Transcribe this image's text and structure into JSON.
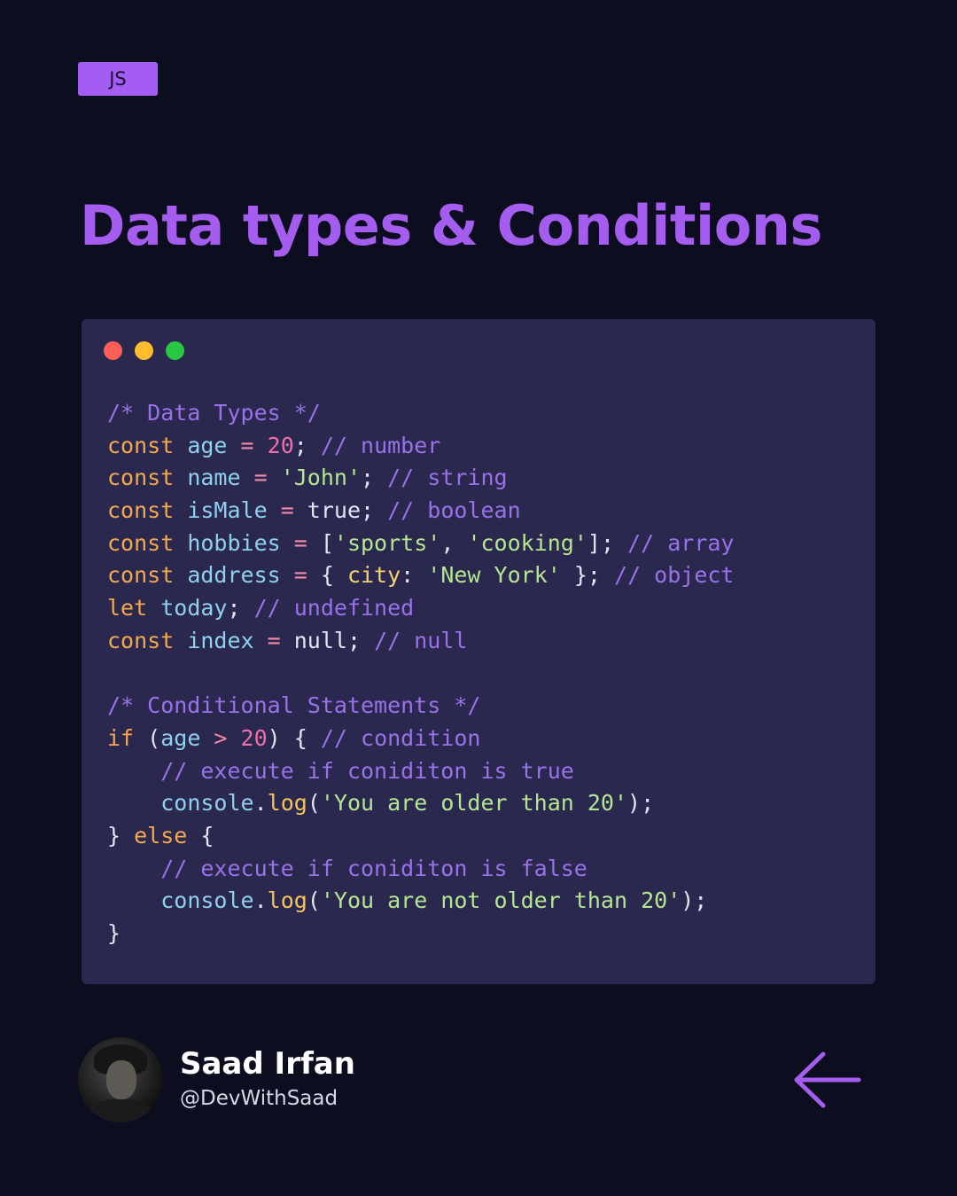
{
  "badge": {
    "label": "JS"
  },
  "title": "Data types & Conditions",
  "window_dots": {
    "colors": [
      "#ff5f57",
      "#febc2e",
      "#28c840"
    ]
  },
  "code": {
    "lines": [
      [
        {
          "t": "/* Data Types */",
          "c": "cm"
        }
      ],
      [
        {
          "t": "const",
          "c": "kw"
        },
        {
          "t": " ",
          "c": "pl"
        },
        {
          "t": "age",
          "c": "id"
        },
        {
          "t": " = ",
          "c": "op"
        },
        {
          "t": "20",
          "c": "num"
        },
        {
          "t": "; ",
          "c": "pl"
        },
        {
          "t": "// number",
          "c": "cm"
        }
      ],
      [
        {
          "t": "const",
          "c": "kw"
        },
        {
          "t": " ",
          "c": "pl"
        },
        {
          "t": "name",
          "c": "id"
        },
        {
          "t": " = ",
          "c": "op"
        },
        {
          "t": "'John'",
          "c": "str"
        },
        {
          "t": "; ",
          "c": "pl"
        },
        {
          "t": "// string",
          "c": "cm"
        }
      ],
      [
        {
          "t": "const",
          "c": "kw"
        },
        {
          "t": " ",
          "c": "pl"
        },
        {
          "t": "isMale",
          "c": "id"
        },
        {
          "t": " = ",
          "c": "op"
        },
        {
          "t": "true",
          "c": "pl"
        },
        {
          "t": "; ",
          "c": "pl"
        },
        {
          "t": "// boolean",
          "c": "cm"
        }
      ],
      [
        {
          "t": "const",
          "c": "kw"
        },
        {
          "t": " ",
          "c": "pl"
        },
        {
          "t": "hobbies",
          "c": "id"
        },
        {
          "t": " = ",
          "c": "op"
        },
        {
          "t": "[",
          "c": "pl"
        },
        {
          "t": "'sports'",
          "c": "str"
        },
        {
          "t": ", ",
          "c": "pl"
        },
        {
          "t": "'cooking'",
          "c": "str"
        },
        {
          "t": "]; ",
          "c": "pl"
        },
        {
          "t": "// array",
          "c": "cm"
        }
      ],
      [
        {
          "t": "const",
          "c": "kw"
        },
        {
          "t": " ",
          "c": "pl"
        },
        {
          "t": "address",
          "c": "id"
        },
        {
          "t": " = ",
          "c": "op"
        },
        {
          "t": "{ ",
          "c": "pl"
        },
        {
          "t": "city",
          "c": "prop"
        },
        {
          "t": ": ",
          "c": "pl"
        },
        {
          "t": "'New York'",
          "c": "str"
        },
        {
          "t": " }; ",
          "c": "pl"
        },
        {
          "t": "// object",
          "c": "cm"
        }
      ],
      [
        {
          "t": "let",
          "c": "kw"
        },
        {
          "t": " ",
          "c": "pl"
        },
        {
          "t": "today",
          "c": "id"
        },
        {
          "t": "; ",
          "c": "pl"
        },
        {
          "t": "// undefined",
          "c": "cm"
        }
      ],
      [
        {
          "t": "const",
          "c": "kw"
        },
        {
          "t": " ",
          "c": "pl"
        },
        {
          "t": "index",
          "c": "id"
        },
        {
          "t": " = ",
          "c": "op"
        },
        {
          "t": "null",
          "c": "pl"
        },
        {
          "t": "; ",
          "c": "pl"
        },
        {
          "t": "// null",
          "c": "cm"
        }
      ],
      [],
      [
        {
          "t": "/* Conditional Statements */",
          "c": "cm"
        }
      ],
      [
        {
          "t": "if",
          "c": "kw"
        },
        {
          "t": " (",
          "c": "pl"
        },
        {
          "t": "age",
          "c": "id"
        },
        {
          "t": " > ",
          "c": "op"
        },
        {
          "t": "20",
          "c": "num"
        },
        {
          "t": ") { ",
          "c": "pl"
        },
        {
          "t": "// condition",
          "c": "cm"
        }
      ],
      [
        {
          "t": "    ",
          "c": "pl"
        },
        {
          "t": "// execute if coniditon is true",
          "c": "cm"
        }
      ],
      [
        {
          "t": "    ",
          "c": "pl"
        },
        {
          "t": "console",
          "c": "id"
        },
        {
          "t": ".",
          "c": "pl"
        },
        {
          "t": "log",
          "c": "fn"
        },
        {
          "t": "(",
          "c": "pl"
        },
        {
          "t": "'You are older than 20'",
          "c": "str"
        },
        {
          "t": ");",
          "c": "pl"
        }
      ],
      [
        {
          "t": "} ",
          "c": "pl"
        },
        {
          "t": "else",
          "c": "kw"
        },
        {
          "t": " {",
          "c": "pl"
        }
      ],
      [
        {
          "t": "    ",
          "c": "pl"
        },
        {
          "t": "// execute if coniditon is false",
          "c": "cm"
        }
      ],
      [
        {
          "t": "    ",
          "c": "pl"
        },
        {
          "t": "console",
          "c": "id"
        },
        {
          "t": ".",
          "c": "pl"
        },
        {
          "t": "log",
          "c": "fn"
        },
        {
          "t": "(",
          "c": "pl"
        },
        {
          "t": "'You are not older than 20'",
          "c": "str"
        },
        {
          "t": ");",
          "c": "pl"
        }
      ],
      [
        {
          "t": "}",
          "c": "pl"
        }
      ]
    ]
  },
  "author": {
    "name": "Saad Irfan",
    "handle": "@DevWithSaad"
  },
  "nav": {
    "arrow_icon": "arrow-left-icon",
    "arrow_color": "#a55df0"
  },
  "colors": {
    "background": "#0c0e1f",
    "accent": "#a55df0",
    "editor": "#2b2850"
  }
}
